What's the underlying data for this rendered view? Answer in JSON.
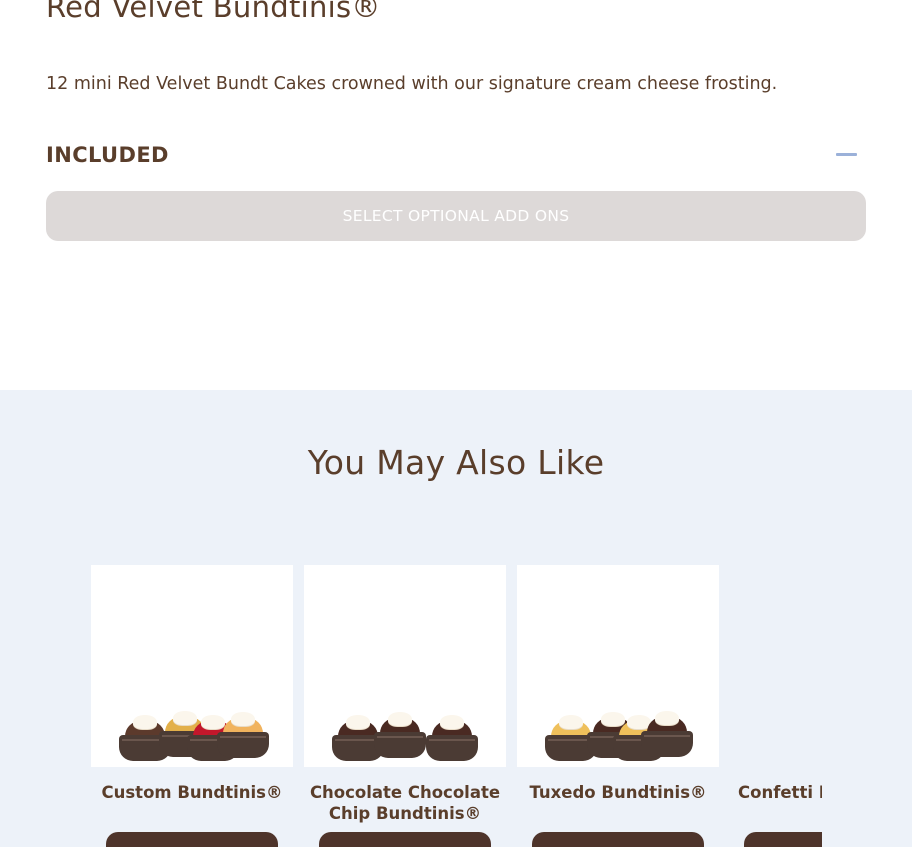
{
  "product": {
    "title": "Red Velvet Bundtinis®",
    "description": "12 mini Red Velvet Bundt Cakes crowned with our signature cream cheese frosting.",
    "included_label": "INCLUDED",
    "addons_button_label": "SELECT OPTIONAL ADD ONS"
  },
  "also_like": {
    "title": "You May Also Like",
    "items": [
      {
        "name": "Custom Bundtinis®"
      },
      {
        "name": "Chocolate Chocolate Chip Bundtinis®"
      },
      {
        "name": "Tuxedo Bundtinis®"
      },
      {
        "name": "Confetti Bundtinis®"
      }
    ]
  },
  "colors": {
    "brand_brown": "#5a3e2b",
    "button_dark": "#4e342b",
    "section_bg": "#edf2f9",
    "addons_bg": "#ddd9d8",
    "accent_blue": "#9bb1d9"
  }
}
